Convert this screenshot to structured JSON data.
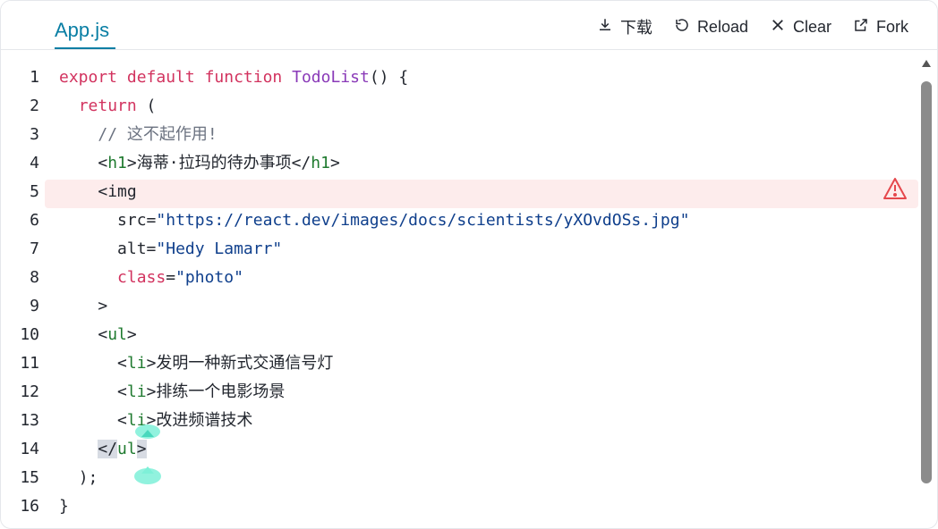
{
  "file_tab": "App.js",
  "toolbar": {
    "download": "下载",
    "reload": "Reload",
    "clear": "Clear",
    "fork": "Fork"
  },
  "line_numbers": [
    "1",
    "2",
    "3",
    "4",
    "5",
    "6",
    "7",
    "8",
    "9",
    "10",
    "11",
    "12",
    "13",
    "14",
    "15",
    "16"
  ],
  "code": {
    "l1_export": "export",
    "l1_default": "default",
    "l1_function": "function",
    "l1_name": "TodoList",
    "l1_rest": "() {",
    "l2_return": "return",
    "l2_paren": " (",
    "l3_comment": "// 这不起作用!",
    "l4_open": "<",
    "l4_tag": "h1",
    "l4_mid": ">海蒂·拉玛的待办事项</",
    "l4_tag2": "h1",
    "l4_close": ">",
    "l5_img": "<img",
    "l6_attr": "src=",
    "l6_val": "\"https://react.dev/images/docs/scientists/yXOvdOSs.jpg\"",
    "l7_attr": "alt=",
    "l7_val": "\"Hedy Lamarr\"",
    "l8_attr": "class",
    "l8_eq": "=",
    "l8_val": "\"photo\"",
    "l9": ">",
    "l10_open": "<",
    "l10_tag": "ul",
    "l10_close": ">",
    "l11_open": "<",
    "l11_tag": "li",
    "l11_text": ">发明一种新式交通信号灯",
    "l12_open": "<",
    "l12_tag": "li",
    "l12_text": ">排练一个电影场景",
    "l13_open": "<",
    "l13_tag": "li",
    "l13_text": ">改进频谱技术",
    "l14_open": "</",
    "l14_tag": "ul",
    "l14_close": ">",
    "l15": ");",
    "l16": "}"
  },
  "colors": {
    "accent": "#087ea4",
    "error_row": "#fdecec",
    "warning": "#e5484d",
    "handle": "#7ef0d8"
  }
}
